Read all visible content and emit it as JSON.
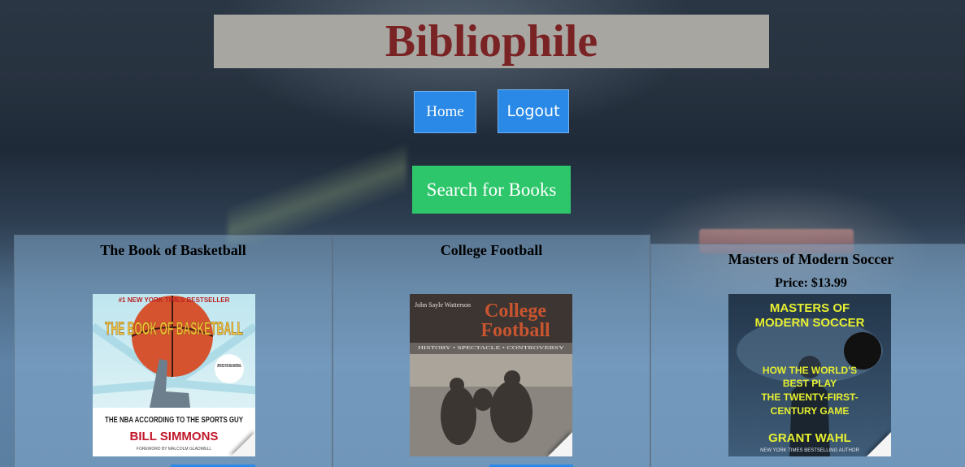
{
  "header": {
    "title": "Bibliophile"
  },
  "nav": {
    "home_label": "Home",
    "logout_label": "Logout"
  },
  "search": {
    "button_label": "Search for Books"
  },
  "books": [
    {
      "title": "The Book of Basketball",
      "price": "",
      "cover": {
        "badge": "#1 NEW YORK TIMES BESTSELLER",
        "headline": "THE BOOK OF BASKETBALL",
        "sticker": "UPDATED FOR NEW MATERIAL",
        "subtitle": "THE NBA ACCORDING TO THE SPORTS GUY",
        "author": "BILL SIMMONS",
        "foreword": "FOREWORD BY MALCOLM GLADWELL"
      }
    },
    {
      "title": "College Football",
      "price": "",
      "cover": {
        "author": "John Sayle Watterson",
        "headline_line1": "College",
        "headline_line2": "Football",
        "subtitle": "HISTORY • SPECTACLE • CONTROVERSY"
      }
    },
    {
      "title": "Masters of Modern Soccer",
      "price": "Price: $13.99",
      "cover": {
        "headline_line1": "MASTERS OF",
        "headline_line2": "MODERN SOCCER",
        "tagline_1": "HOW THE WORLD'S",
        "tagline_2": "BEST PLAY",
        "tagline_3": "THE TWENTY-FIRST-",
        "tagline_4": "CENTURY GAME",
        "author": "GRANT WAHL",
        "badge": "NEW YORK TIMES BESTSELLING AUTHOR"
      }
    }
  ],
  "colors": {
    "title": "#7a2325",
    "title_bar": "#a8a6a1",
    "nav_button": "#2a89e6",
    "search_button": "#2ec66b"
  }
}
